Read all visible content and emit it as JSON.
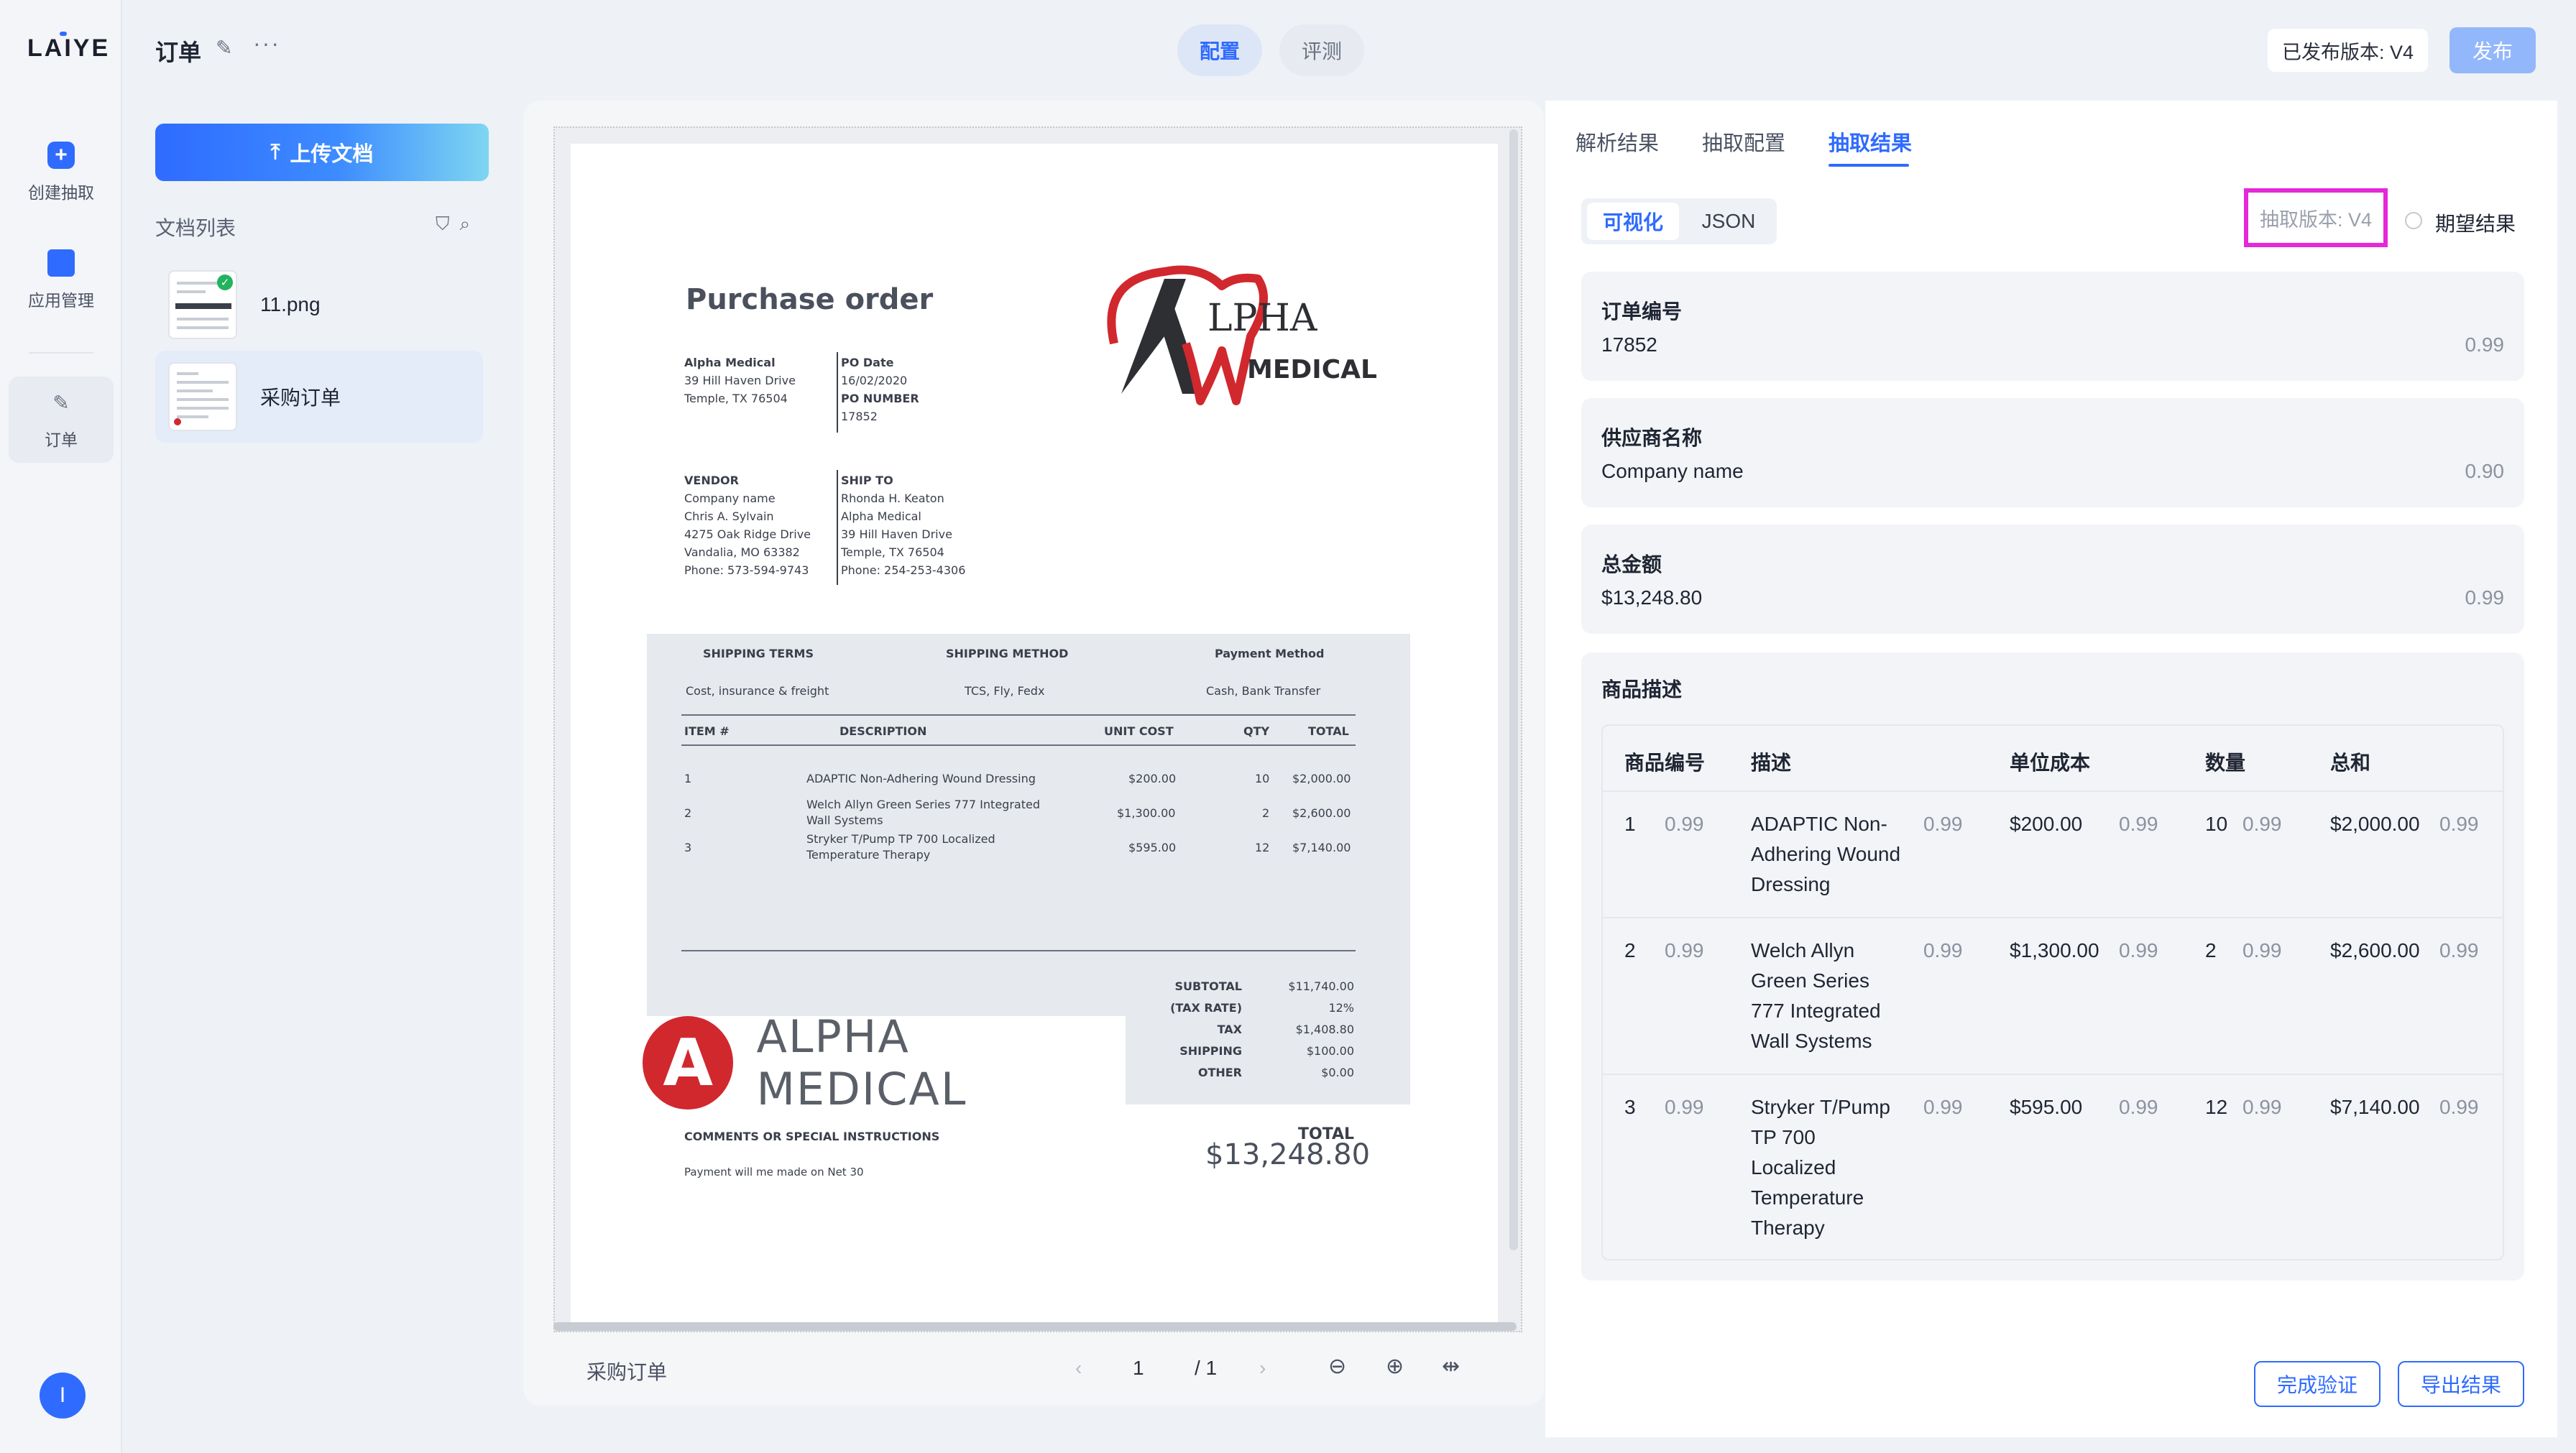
{
  "rail": {
    "logo": "LAIYE",
    "items": [
      {
        "label": "创建抽取",
        "icon": "plus-icon"
      },
      {
        "label": "应用管理",
        "icon": "folder-icon"
      },
      {
        "label": "订单",
        "icon": "document-edit-icon"
      }
    ],
    "avatar": "I"
  },
  "header": {
    "title": "订单",
    "tabs": [
      "配置",
      "评测"
    ],
    "published_version": "已发布版本: V4",
    "publish_label": "发布"
  },
  "docs": {
    "upload_label": "上传文档",
    "list_title": "文档列表",
    "items": [
      {
        "name": "11.png"
      },
      {
        "name": "采购订单"
      }
    ]
  },
  "preview": {
    "doc_name": "采购订单",
    "page_current": "1",
    "page_total": "/ 1"
  },
  "po": {
    "title": "Purchase order",
    "from": [
      "Alpha Medical",
      "39 Hill Haven Drive",
      "Temple, TX 76504"
    ],
    "po_meta": [
      "PO Date",
      "16/02/2020",
      "PO NUMBER",
      "17852"
    ],
    "vendor": [
      "VENDOR",
      "Company name",
      "Chris A. Sylvain",
      "4275 Oak Ridge Drive",
      "Vandalia, MO 63382",
      "Phone: 573-594-9743"
    ],
    "ship_to": [
      "SHIP TO",
      "Rhonda H. Keaton",
      "Alpha Medical",
      "39 Hill Haven Drive",
      "Temple, TX 76504",
      "Phone: 254-253-4306"
    ],
    "logo_main": "LPHA",
    "logo_sub": "MEDICAL",
    "terms_headers": [
      "SHIPPING TERMS",
      "SHIPPING METHOD",
      "Payment Method"
    ],
    "terms_values": [
      "Cost, insurance & freight",
      "TCS, Fly, Fedx",
      "Cash, Bank Transfer"
    ],
    "item_headers": [
      "ITEM #",
      "DESCRIPTION",
      "UNIT COST",
      "QTY",
      "TOTAL"
    ],
    "rows": [
      {
        "num": "1",
        "desc1": "ADAPTIC Non-Adhering Wound Dressing",
        "desc2": "",
        "unit": "$200.00",
        "qty": "10",
        "total": "$2,000.00"
      },
      {
        "num": "2",
        "desc1": "Welch Allyn Green Series 777 Integrated",
        "desc2": "Wall Systems",
        "unit": "$1,300.00",
        "qty": "2",
        "total": "$2,600.00"
      },
      {
        "num": "3",
        "desc1": "Stryker T/Pump TP 700 Localized",
        "desc2": "Temperature Therapy",
        "unit": "$595.00",
        "qty": "12",
        "total": "$7,140.00"
      }
    ],
    "summary_labels": [
      "SUBTOTAL",
      "(TAX RATE)",
      "TAX",
      "SHIPPING",
      "OTHER"
    ],
    "summary_values": [
      "$11,740.00",
      "12%",
      "$1,408.80",
      "$100.00",
      "$0.00"
    ],
    "logo2_letter": "A",
    "logo2_text": "ALPHA MEDICAL",
    "comments_label": "COMMENTS OR SPECIAL INSTRUCTIONS",
    "comments_text": "Payment will me made on Net 30",
    "total_label": "TOTAL",
    "total_value": "$13,248.80"
  },
  "results": {
    "tabs": [
      "解析结果",
      "抽取配置",
      "抽取结果"
    ],
    "view_modes": [
      "可视化",
      "JSON"
    ],
    "extract_version": "抽取版本: V4",
    "expected_label": "期望结果",
    "fields": [
      {
        "label": "订单编号",
        "value": "17852",
        "score": "0.99"
      },
      {
        "label": "供应商名称",
        "value": "Company name",
        "score": "0.90"
      },
      {
        "label": "总金额",
        "value": "$13,248.80",
        "score": "0.99"
      }
    ],
    "items_title": "商品描述",
    "item_headers": [
      "商品编号",
      "描述",
      "单位成本",
      "数量",
      "总和"
    ],
    "items": [
      {
        "num": "1",
        "num_score": "0.99",
        "desc": [
          "ADAPTIC Non-",
          "Adhering Wound",
          "Dressing"
        ],
        "desc_score": "0.99",
        "unit": "$200.00",
        "unit_score": "0.99",
        "qty": "10",
        "qty_score": "0.99",
        "total": "$2,000.00",
        "total_score": "0.99"
      },
      {
        "num": "2",
        "num_score": "0.99",
        "desc": [
          "Welch Allyn",
          "Green Series",
          "777 Integrated",
          "Wall Systems"
        ],
        "desc_score": "0.99",
        "unit": "$1,300.00",
        "unit_score": "0.99",
        "qty": "2",
        "qty_score": "0.99",
        "total": "$2,600.00",
        "total_score": "0.99"
      },
      {
        "num": "3",
        "num_score": "0.99",
        "desc": [
          "Stryker T/Pump",
          "TP 700",
          "Localized",
          "Temperature",
          "Therapy"
        ],
        "desc_score": "0.99",
        "unit": "$595.00",
        "unit_score": "0.99",
        "qty": "12",
        "qty_score": "0.99",
        "total": "$7,140.00",
        "total_score": "0.99"
      }
    ],
    "complete_label": "完成验证",
    "export_label": "导出结果"
  },
  "colors": {
    "accent": "#2f6bff",
    "highlight": "#e528d8",
    "logo_red": "#d1282e"
  }
}
